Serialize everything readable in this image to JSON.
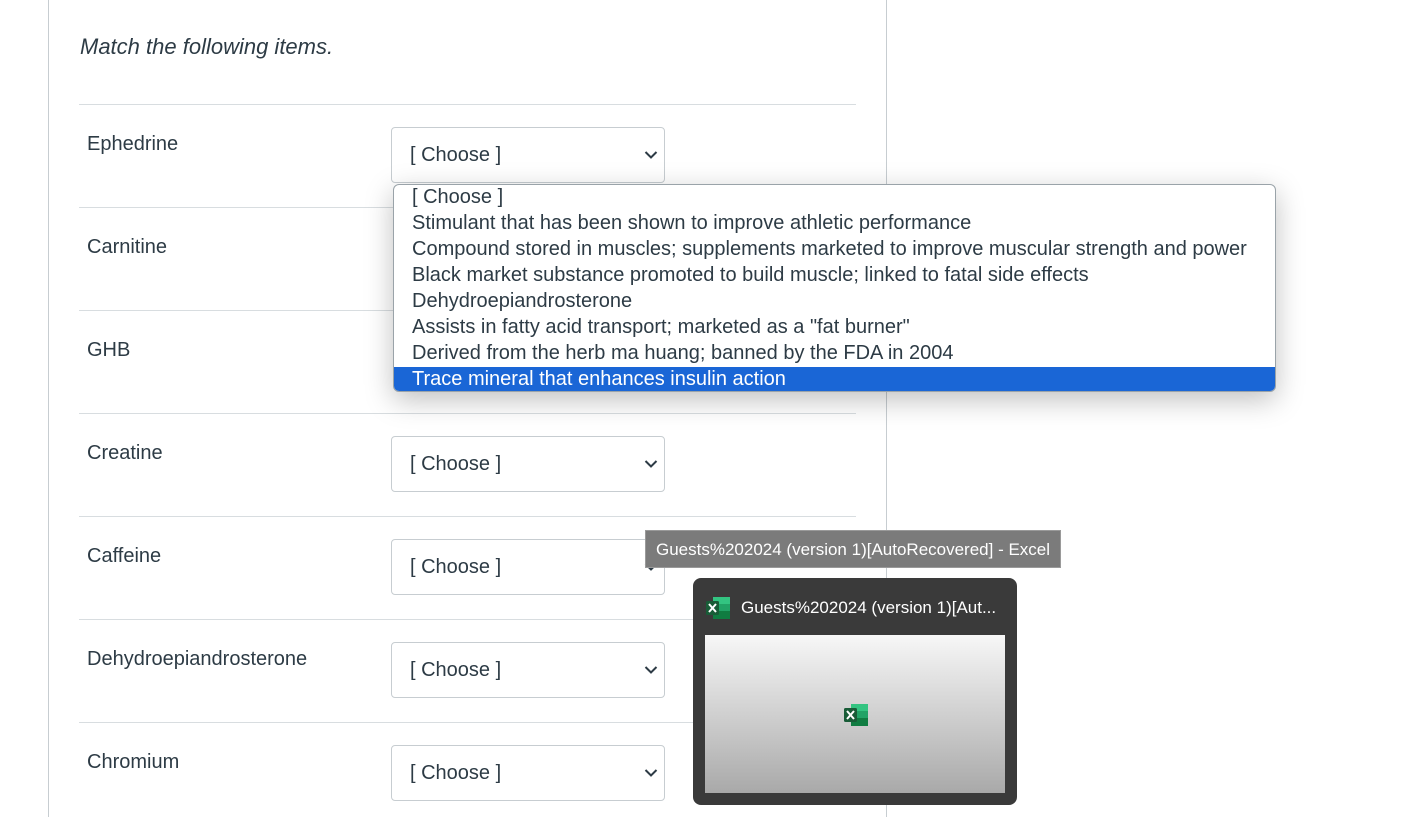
{
  "prompt": "Match the following items.",
  "items": [
    {
      "label": "Ephedrine",
      "value": "[ Choose ]"
    },
    {
      "label": "Carnitine",
      "value": "[ Choose ]"
    },
    {
      "label": "GHB",
      "value": "[ Choose ]"
    },
    {
      "label": "Creatine",
      "value": "[ Choose ]"
    },
    {
      "label": "Caffeine",
      "value": "[ Choose ]"
    },
    {
      "label": "Dehydroepiandrosterone",
      "value": "[ Choose ]"
    },
    {
      "label": "Chromium",
      "value": "[ Choose ]"
    }
  ],
  "dropdown": {
    "options": [
      "[ Choose ]",
      "Stimulant that has been shown to improve athletic performance",
      "Compound stored in muscles; supplements marketed to improve muscular strength and power",
      "Black market substance promoted to build muscle; linked to fatal side effects",
      "Dehydroepiandrosterone",
      "Assists in fatty acid transport; marketed as a \"fat burner\"",
      "Derived from the herb ma huang; banned by the FDA in 2004",
      "Trace mineral that enhances insulin action"
    ],
    "highlighted": "Trace mineral that enhances insulin action"
  },
  "taskbar": {
    "tooltip": "Guests%202024 (version 1)[AutoRecovered] - Excel",
    "thumb_title": "Guests%202024 (version 1)[Aut...",
    "app_icon": "excel-icon"
  },
  "colors": {
    "highlight": "#1a66d6",
    "excel_green": "#1d6f42"
  }
}
